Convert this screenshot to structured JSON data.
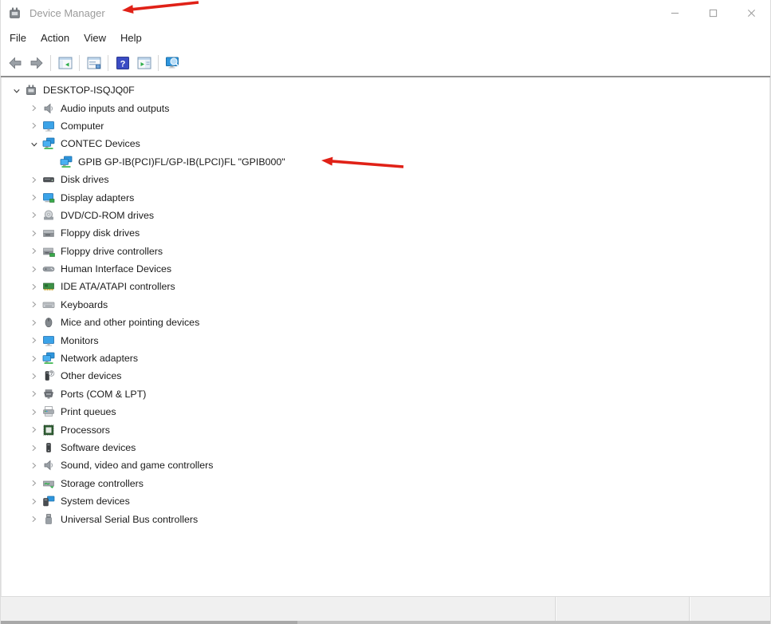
{
  "window": {
    "title": "Device Manager",
    "app_icon": "device-manager-icon",
    "controls": [
      {
        "name": "minimize",
        "icon": "minimize-icon"
      },
      {
        "name": "maximize",
        "icon": "maximize-icon"
      },
      {
        "name": "close",
        "icon": "close-icon"
      }
    ]
  },
  "menu": {
    "items": [
      "File",
      "Action",
      "View",
      "Help"
    ]
  },
  "toolbar": {
    "items": [
      {
        "type": "button",
        "icon": "back-arrow-icon",
        "name": "back"
      },
      {
        "type": "button",
        "icon": "forward-arrow-icon",
        "name": "forward"
      },
      {
        "type": "separator"
      },
      {
        "type": "button",
        "icon": "console-tree-icon",
        "name": "show-hide-console-tree"
      },
      {
        "type": "separator"
      },
      {
        "type": "button",
        "icon": "properties-icon",
        "name": "properties"
      },
      {
        "type": "separator"
      },
      {
        "type": "button",
        "icon": "help-icon",
        "name": "help"
      },
      {
        "type": "button",
        "icon": "action-pane-icon",
        "name": "show-hide-action-pane"
      },
      {
        "type": "separator"
      },
      {
        "type": "button",
        "icon": "scan-hardware-icon",
        "name": "scan-for-hardware-changes"
      }
    ]
  },
  "tree": {
    "items": [
      {
        "label": "DESKTOP-ISQJQ0F",
        "icon": "computer-icon",
        "level": 0,
        "state": "expanded"
      },
      {
        "label": "Audio inputs and outputs",
        "icon": "speaker-icon",
        "level": 1,
        "state": "collapsed"
      },
      {
        "label": "Computer",
        "icon": "monitor-icon",
        "level": 1,
        "state": "collapsed"
      },
      {
        "label": "CONTEC Devices",
        "icon": "network-adapter-icon",
        "level": 1,
        "state": "expanded"
      },
      {
        "label": "GPIB GP-IB(PCI)FL/GP-IB(LPCI)FL \"GPIB000\"",
        "icon": "network-adapter-icon",
        "level": 2,
        "state": "leaf"
      },
      {
        "label": "Disk drives",
        "icon": "disk-drive-icon",
        "level": 1,
        "state": "collapsed"
      },
      {
        "label": "Display adapters",
        "icon": "display-adapter-icon",
        "level": 1,
        "state": "collapsed"
      },
      {
        "label": "DVD/CD-ROM drives",
        "icon": "dvd-drive-icon",
        "level": 1,
        "state": "collapsed"
      },
      {
        "label": "Floppy disk drives",
        "icon": "floppy-drive-icon",
        "level": 1,
        "state": "collapsed"
      },
      {
        "label": "Floppy drive controllers",
        "icon": "floppy-controller-icon",
        "level": 1,
        "state": "collapsed"
      },
      {
        "label": "Human Interface Devices",
        "icon": "hid-icon",
        "level": 1,
        "state": "collapsed"
      },
      {
        "label": "IDE ATA/ATAPI controllers",
        "icon": "ide-controller-icon",
        "level": 1,
        "state": "collapsed"
      },
      {
        "label": "Keyboards",
        "icon": "keyboard-icon",
        "level": 1,
        "state": "collapsed"
      },
      {
        "label": "Mice and other pointing devices",
        "icon": "mouse-icon",
        "level": 1,
        "state": "collapsed"
      },
      {
        "label": "Monitors",
        "icon": "monitor-icon",
        "level": 1,
        "state": "collapsed"
      },
      {
        "label": "Network adapters",
        "icon": "network-adapter-icon",
        "level": 1,
        "state": "collapsed"
      },
      {
        "label": "Other devices",
        "icon": "unknown-device-icon",
        "level": 1,
        "state": "collapsed"
      },
      {
        "label": "Ports (COM & LPT)",
        "icon": "serial-port-icon",
        "level": 1,
        "state": "collapsed"
      },
      {
        "label": "Print queues",
        "icon": "printer-icon",
        "level": 1,
        "state": "collapsed"
      },
      {
        "label": "Processors",
        "icon": "processor-icon",
        "level": 1,
        "state": "collapsed"
      },
      {
        "label": "Software devices",
        "icon": "software-device-icon",
        "level": 1,
        "state": "collapsed"
      },
      {
        "label": "Sound, video and game controllers",
        "icon": "speaker-icon",
        "level": 1,
        "state": "collapsed"
      },
      {
        "label": "Storage controllers",
        "icon": "storage-controller-icon",
        "level": 1,
        "state": "collapsed"
      },
      {
        "label": "System devices",
        "icon": "system-device-icon",
        "level": 1,
        "state": "collapsed"
      },
      {
        "label": "Universal Serial Bus controllers",
        "icon": "usb-icon",
        "level": 1,
        "state": "collapsed"
      }
    ]
  },
  "annotations": {
    "arrow_color": "#e02117",
    "arrows": [
      {
        "points_at": "window-title"
      },
      {
        "points_at": "tree-item-gpib-device"
      }
    ]
  },
  "colors": {
    "device_blue": "#2e95dd",
    "device_green": "#39b54a",
    "inactive_title_text": "#9b9b9b",
    "statusbar_bg": "#f0f0f0"
  }
}
